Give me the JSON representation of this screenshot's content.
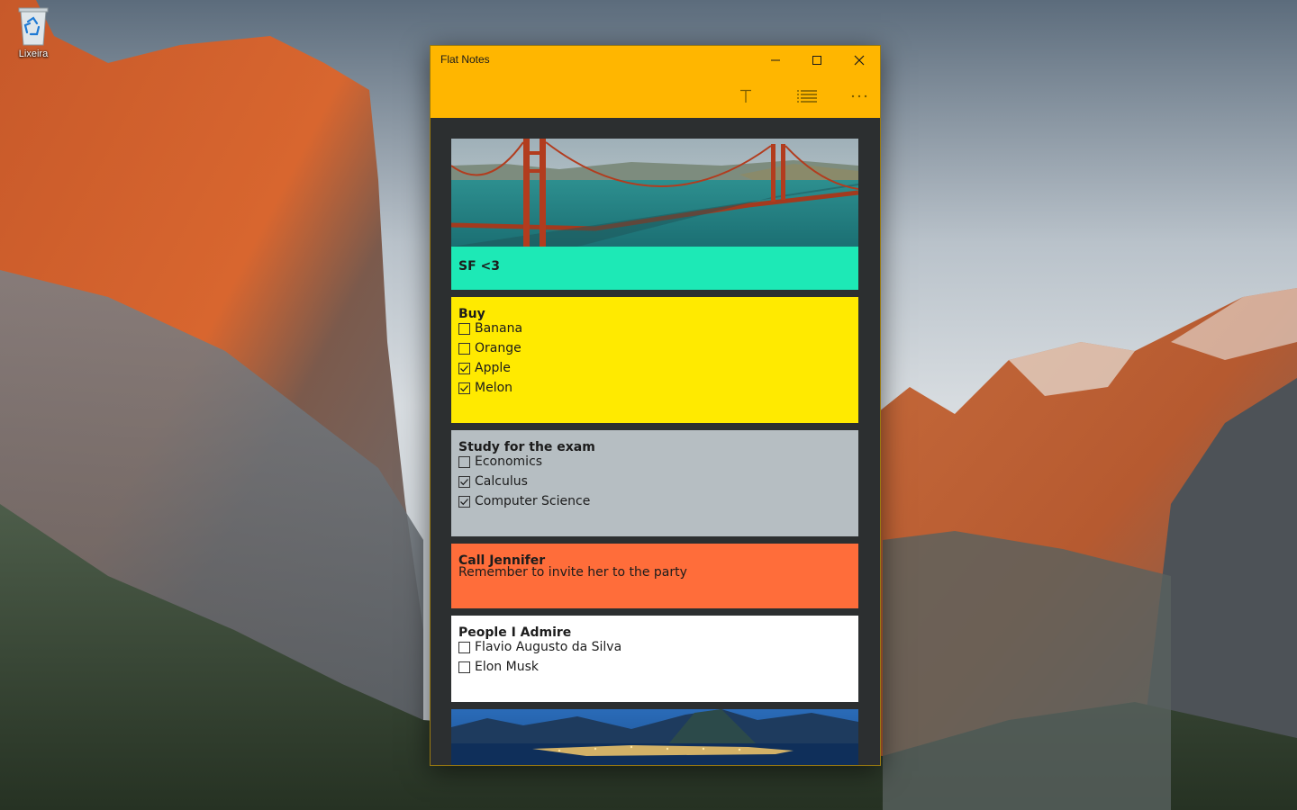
{
  "desktop": {
    "recycle_bin_label": "Lixeira"
  },
  "window": {
    "title": "Flat Notes",
    "accent_color": "#ffb600",
    "controls": {
      "minimize_icon": "minimize-icon",
      "maximize_icon": "maximize-icon",
      "close_icon": "close-icon"
    },
    "toolbar": {
      "text_note_icon": "text-note-icon",
      "list_note_icon": "list-note-icon",
      "more_icon": "more-icon"
    }
  },
  "notes": [
    {
      "type": "image",
      "title": "SF <3",
      "image": "golden-gate-bridge-photo",
      "color": "#1de9b6"
    },
    {
      "type": "checklist",
      "title": "Buy",
      "color": "#ffea00",
      "items": [
        {
          "label": "Banana",
          "checked": false
        },
        {
          "label": "Orange",
          "checked": false
        },
        {
          "label": "Apple",
          "checked": true
        },
        {
          "label": "Melon",
          "checked": true
        }
      ]
    },
    {
      "type": "checklist",
      "title": "Study for the exam",
      "color": "#b6bec2",
      "items": [
        {
          "label": "Economics",
          "checked": false
        },
        {
          "label": "Calculus",
          "checked": true
        },
        {
          "label": "Computer Science",
          "checked": true
        }
      ]
    },
    {
      "type": "text",
      "title": "Call Jennifer",
      "text": "Remember to invite her to the party",
      "color": "#ff6d3a"
    },
    {
      "type": "checklist",
      "title": "People I Admire",
      "color": "#ffffff",
      "items": [
        {
          "label": "Flavio Augusto da Silva",
          "checked": false
        },
        {
          "label": "Elon Musk",
          "checked": false
        }
      ]
    },
    {
      "type": "image",
      "image": "rio-de-janeiro-night-photo"
    }
  ]
}
